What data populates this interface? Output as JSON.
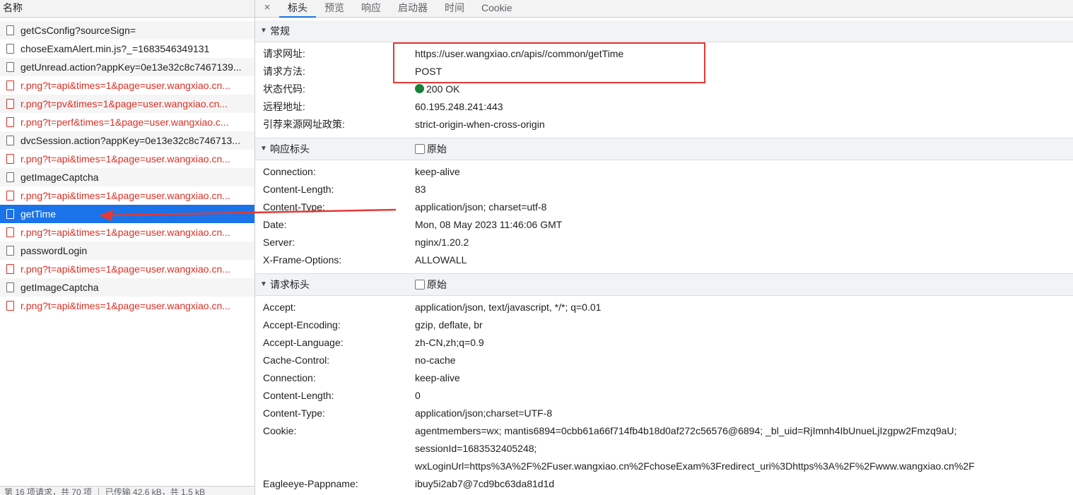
{
  "left": {
    "header": "名称",
    "requests": [
      {
        "name": "getCsConfig?sourceSign=",
        "status": "normal",
        "selected": false
      },
      {
        "name": "choseExamAlert.min.js?_=1683546349131",
        "status": "normal",
        "selected": false
      },
      {
        "name": "getUnread.action?appKey=0e13e32c8c7467139...",
        "status": "normal",
        "selected": false
      },
      {
        "name": "r.png?t=api&times=1&page=user.wangxiao.cn...",
        "status": "error",
        "selected": false
      },
      {
        "name": "r.png?t=pv&times=1&page=user.wangxiao.cn...",
        "status": "error",
        "selected": false
      },
      {
        "name": "r.png?t=perf&times=1&page=user.wangxiao.c...",
        "status": "error",
        "selected": false
      },
      {
        "name": "dvcSession.action?appKey=0e13e32c8c746713...",
        "status": "normal",
        "selected": false
      },
      {
        "name": "r.png?t=api&times=1&page=user.wangxiao.cn...",
        "status": "error",
        "selected": false
      },
      {
        "name": "getImageCaptcha",
        "status": "normal",
        "selected": false
      },
      {
        "name": "r.png?t=api&times=1&page=user.wangxiao.cn...",
        "status": "error",
        "selected": false
      },
      {
        "name": "getTime",
        "status": "normal",
        "selected": true
      },
      {
        "name": "r.png?t=api&times=1&page=user.wangxiao.cn...",
        "status": "error",
        "selected": false
      },
      {
        "name": "passwordLogin",
        "status": "normal",
        "selected": false
      },
      {
        "name": "r.png?t=api&times=1&page=user.wangxiao.cn...",
        "status": "error",
        "selected": false
      },
      {
        "name": "getImageCaptcha",
        "status": "normal",
        "selected": false
      },
      {
        "name": "r.png?t=api&times=1&page=user.wangxiao.cn...",
        "status": "error",
        "selected": false
      }
    ],
    "footer": "第 16 项请求，共 70 项 ｜ 已传输 42.6 kB，共 1.5 kB"
  },
  "tabs": {
    "close_glyph": "×",
    "items": [
      "标头",
      "预览",
      "响应",
      "启动器",
      "时间",
      "Cookie"
    ],
    "active": 0
  },
  "sections": [
    {
      "id": "general",
      "title": "常规",
      "has_raw": false,
      "rows": [
        {
          "key": "请求网址:",
          "value": "https://user.wangxiao.cn/apis//common/getTime"
        },
        {
          "key": "请求方法:",
          "value": "POST"
        },
        {
          "key": "状态代码:",
          "value": "200 OK",
          "status_dot": true
        },
        {
          "key": "远程地址:",
          "value": "60.195.248.241:443"
        },
        {
          "key": "引荐来源网址政策:",
          "value": "strict-origin-when-cross-origin"
        }
      ]
    },
    {
      "id": "response-headers",
      "title": "响应标头",
      "has_raw": true,
      "raw_label": "原始",
      "rows": [
        {
          "key": "Connection:",
          "value": "keep-alive"
        },
        {
          "key": "Content-Length:",
          "value": "83"
        },
        {
          "key": "Content-Type:",
          "value": "application/json; charset=utf-8"
        },
        {
          "key": "Date:",
          "value": "Mon, 08 May 2023 11:46:06 GMT"
        },
        {
          "key": "Server:",
          "value": "nginx/1.20.2"
        },
        {
          "key": "X-Frame-Options:",
          "value": "ALLOWALL"
        }
      ]
    },
    {
      "id": "request-headers",
      "title": "请求标头",
      "has_raw": true,
      "raw_label": "原始",
      "rows": [
        {
          "key": "Accept:",
          "value": "application/json, text/javascript, */*; q=0.01"
        },
        {
          "key": "Accept-Encoding:",
          "value": "gzip, deflate, br"
        },
        {
          "key": "Accept-Language:",
          "value": "zh-CN,zh;q=0.9"
        },
        {
          "key": "Cache-Control:",
          "value": "no-cache"
        },
        {
          "key": "Connection:",
          "value": "keep-alive"
        },
        {
          "key": "Content-Length:",
          "value": "0"
        },
        {
          "key": "Content-Type:",
          "value": "application/json;charset=UTF-8"
        },
        {
          "key": "Cookie:",
          "value": "agentmembers=wx; mantis6894=0cbb61a66f714fb4b18d0af272c56576@6894; _bl_uid=RjImnh4IbUnueLjIzgpw2Fmzq9aU;"
        },
        {
          "key": "",
          "value": "sessionId=1683532405248;"
        },
        {
          "key": "",
          "value": "wxLoginUrl=https%3A%2F%2Fuser.wangxiao.cn%2FchoseExam%3Fredirect_uri%3Dhttps%3A%2F%2Fwww.wangxiao.cn%2F"
        },
        {
          "key": "Eagleeye-Pappname:",
          "value": "ibuy5i2ab7@7cd9bc63da81d1d"
        }
      ]
    }
  ],
  "colors": {
    "selection": "#1a73e8",
    "error_text": "#d93025",
    "status_ok": "#188038",
    "annotation": "#e53935"
  }
}
